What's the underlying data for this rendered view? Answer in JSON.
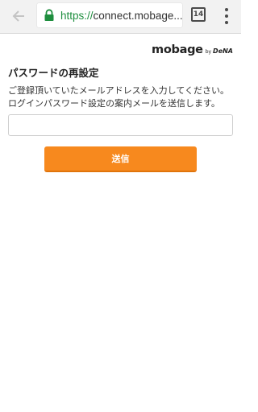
{
  "browser": {
    "url_scheme": "https://",
    "url_host": "connect.mobage.",
    "url_ellipsis": "...",
    "tab_count": "14",
    "back_icon": "arrow-left-icon",
    "lock_icon": "lock-icon",
    "menu_icon": "vertical-dots-icon",
    "secure_color": "#1e8e3e"
  },
  "header": {
    "logo_text": "mobage",
    "logo_by": "by",
    "logo_dena": "DeNA"
  },
  "main": {
    "title": "パスワードの再設定",
    "instructions": [
      "ご登録頂いていたメールアドレスを入力してください。",
      "ログインパスワード設定の案内メールを送信します。"
    ],
    "email_value": "",
    "submit_label": "送信",
    "accent_color": "#f7891e"
  }
}
